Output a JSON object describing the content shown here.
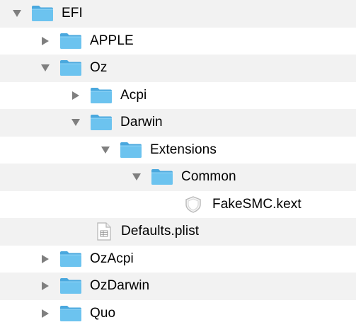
{
  "finder": {
    "items": [
      {
        "name": "EFI",
        "type": "folder",
        "expanded": true
      },
      {
        "name": "APPLE",
        "type": "folder",
        "expanded": false
      },
      {
        "name": "Oz",
        "type": "folder",
        "expanded": true
      },
      {
        "name": "Acpi",
        "type": "folder",
        "expanded": false
      },
      {
        "name": "Darwin",
        "type": "folder",
        "expanded": true
      },
      {
        "name": "Extensions",
        "type": "folder",
        "expanded": true
      },
      {
        "name": "Common",
        "type": "folder",
        "expanded": true
      },
      {
        "name": "FakeSMC.kext",
        "type": "kext-bundle",
        "expanded": null
      },
      {
        "name": "Defaults.plist",
        "type": "plist-file",
        "expanded": null
      },
      {
        "name": "OzAcpi",
        "type": "folder",
        "expanded": false
      },
      {
        "name": "OzDarwin",
        "type": "folder",
        "expanded": false
      },
      {
        "name": "Quo",
        "type": "folder",
        "expanded": false
      }
    ]
  },
  "colors": {
    "stripe": "#f2f2f2",
    "folder_body": "#6cc3ef",
    "folder_tab": "#4aa8de",
    "triangle": "#7f7f7f"
  },
  "icons": {
    "folder": "folder-icon",
    "kext": "kext-bundle-icon",
    "plist": "plist-file-icon",
    "expanded": "disclosure-triangle-down-icon",
    "collapsed": "disclosure-triangle-right-icon"
  }
}
